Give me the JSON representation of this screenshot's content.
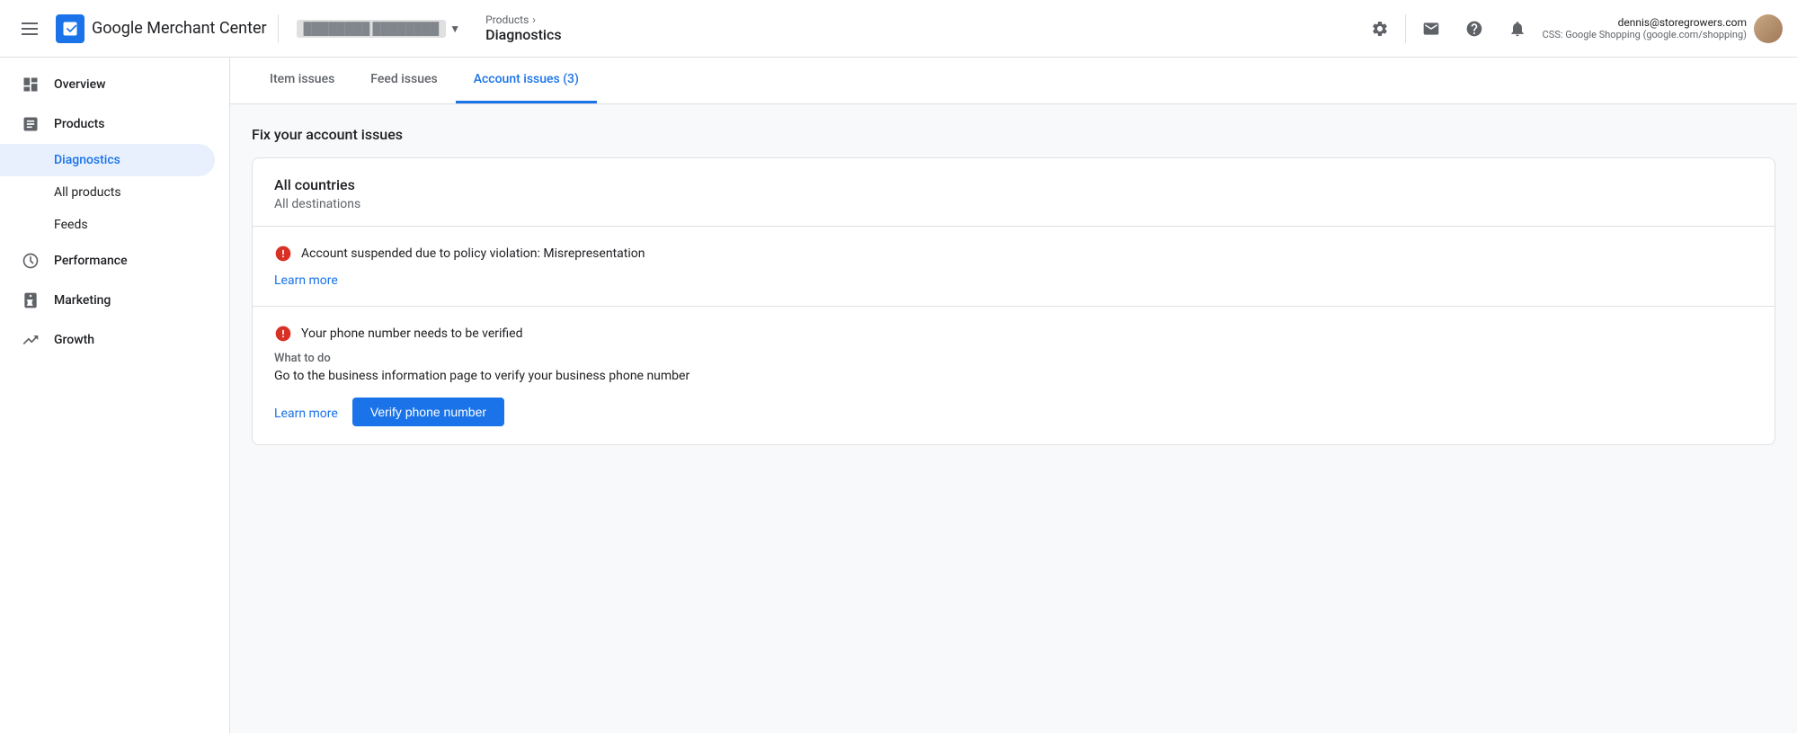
{
  "header": {
    "menu_icon": "hamburger-icon",
    "logo_text": "Google Merchant Center",
    "account_name": "blurred account",
    "breadcrumb_parent": "Products",
    "breadcrumb_current": "Diagnostics",
    "icons": {
      "settings": "gear-icon",
      "mail": "mail-icon",
      "help": "help-icon",
      "notification": "bell-icon"
    },
    "user": {
      "email": "dennis@storegrowers.com",
      "css": "CSS: Google Shopping (google.com/shopping)"
    }
  },
  "sidebar": {
    "items": [
      {
        "id": "overview",
        "label": "Overview",
        "icon": "overview-icon"
      },
      {
        "id": "products",
        "label": "Products",
        "icon": "products-icon"
      },
      {
        "id": "performance",
        "label": "Performance",
        "icon": "performance-icon"
      },
      {
        "id": "marketing",
        "label": "Marketing",
        "icon": "marketing-icon"
      },
      {
        "id": "growth",
        "label": "Growth",
        "icon": "growth-icon"
      }
    ],
    "sub_items": [
      {
        "id": "diagnostics",
        "label": "Diagnostics",
        "active": true
      },
      {
        "id": "all-products",
        "label": "All products"
      },
      {
        "id": "feeds",
        "label": "Feeds"
      }
    ]
  },
  "tabs": [
    {
      "id": "item-issues",
      "label": "Item issues",
      "active": false
    },
    {
      "id": "feed-issues",
      "label": "Feed issues",
      "active": false
    },
    {
      "id": "account-issues",
      "label": "Account issues (3)",
      "active": true
    }
  ],
  "main": {
    "section_title": "Fix your account issues",
    "card": {
      "country": "All countries",
      "destinations": "All destinations",
      "issues": [
        {
          "id": "issue-1",
          "icon": "error-icon",
          "title": "Account suspended due to policy violation: Misrepresentation",
          "learn_more_label": "Learn more",
          "has_what_to_do": false
        },
        {
          "id": "issue-2",
          "icon": "error-icon",
          "title": "Your phone number needs to be verified",
          "learn_more_label": "Learn more",
          "has_what_to_do": true,
          "what_to_do_label": "What to do",
          "what_to_do_desc": "Go to the business information page to verify your business phone number",
          "action_button_label": "Verify phone number"
        }
      ]
    }
  }
}
